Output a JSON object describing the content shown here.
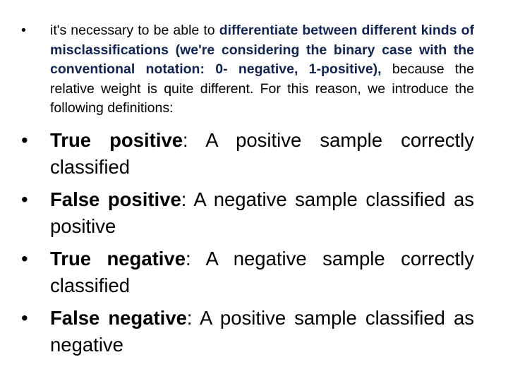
{
  "bullet_glyph": "•",
  "intro": {
    "lead": "it's necessary to be able to ",
    "highlight": "differentiate between different kinds of misclassifications (we're considering the binary case with the conventional notation: 0- negative, 1-positive),",
    "tail": " because the relative weight is quite different. For this reason, we introduce the following definitions:"
  },
  "definitions": [
    {
      "term": "True positive",
      "description": ": A positive sample correctly classified"
    },
    {
      "term": "False positive",
      "description": ": A negative sample classified as positive"
    },
    {
      "term": "True negative",
      "description": ": A negative sample correctly classified"
    },
    {
      "term": "False negative",
      "description": ": A positive sample classified as negative"
    }
  ],
  "colors": {
    "highlight": "#13254f",
    "text": "#000000",
    "background": "#ffffff"
  }
}
